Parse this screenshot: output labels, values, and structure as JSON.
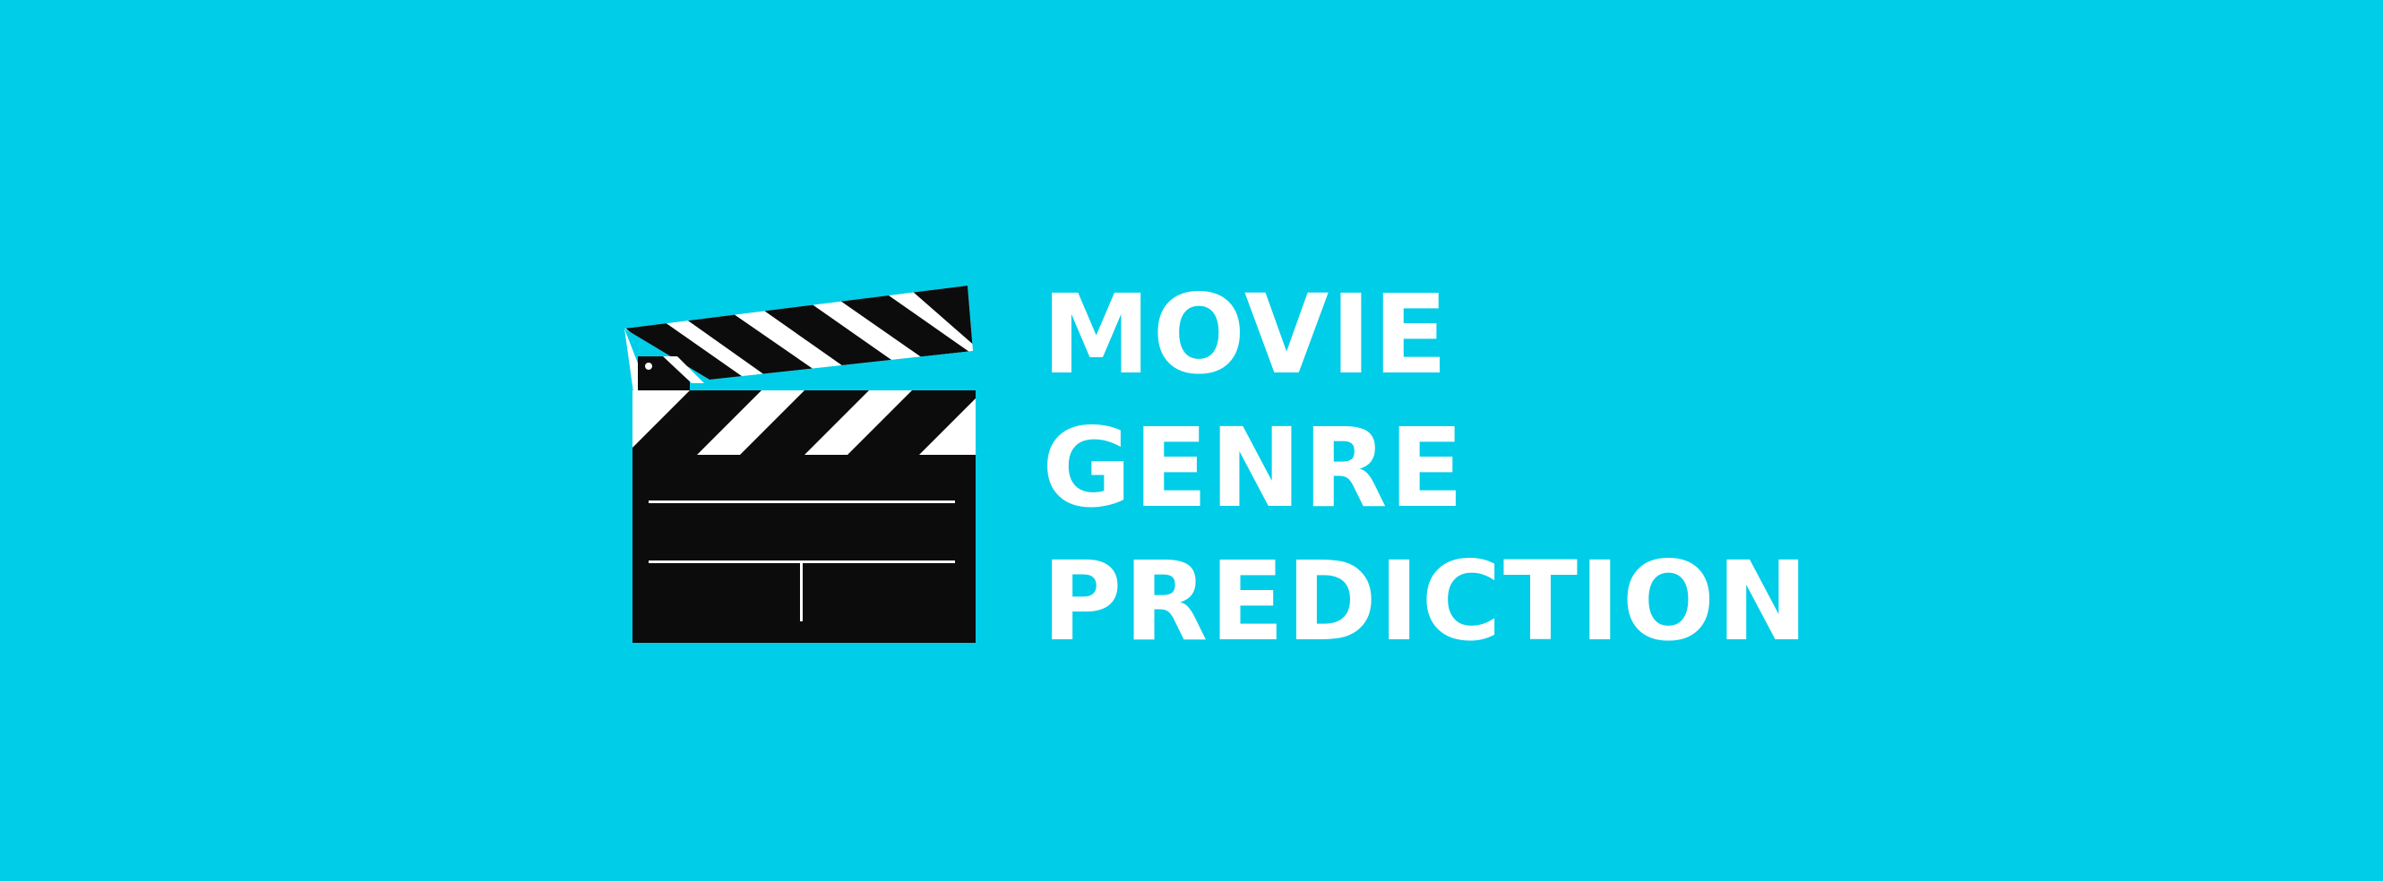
{
  "banner": {
    "background_color": "#00cde8",
    "logo_icon": "clapperboard-icon",
    "title_lines": [
      "MOVIE",
      "GENRE",
      "PREDICTION"
    ],
    "text_color": "#ffffff"
  }
}
